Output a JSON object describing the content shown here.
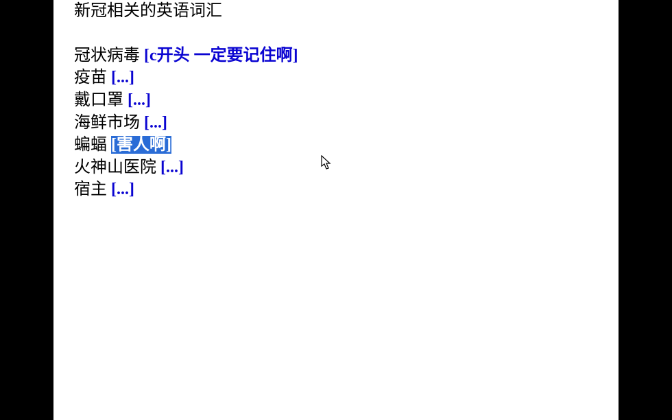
{
  "title": "新冠相关的英语词汇",
  "items": [
    {
      "term": "冠状病毒",
      "hint": "[c开头 一定要记住啊]",
      "selected": false
    },
    {
      "term": "疫苗",
      "hint": "[...]",
      "selected": false
    },
    {
      "term": "戴口罩",
      "hint": "[...]",
      "selected": false
    },
    {
      "term": "海鲜市场",
      "hint": "[...]",
      "selected": false
    },
    {
      "term": "蝙蝠",
      "hint": "[害人啊]",
      "selected": true
    },
    {
      "term": "火神山医院",
      "hint": "[...]",
      "selected": false
    },
    {
      "term": "宿主",
      "hint": "[...]",
      "selected": false
    }
  ],
  "colors": {
    "hint": "#0a04d1",
    "selection_bg": "#2a6cd6",
    "selection_fg": "#ffffff"
  }
}
